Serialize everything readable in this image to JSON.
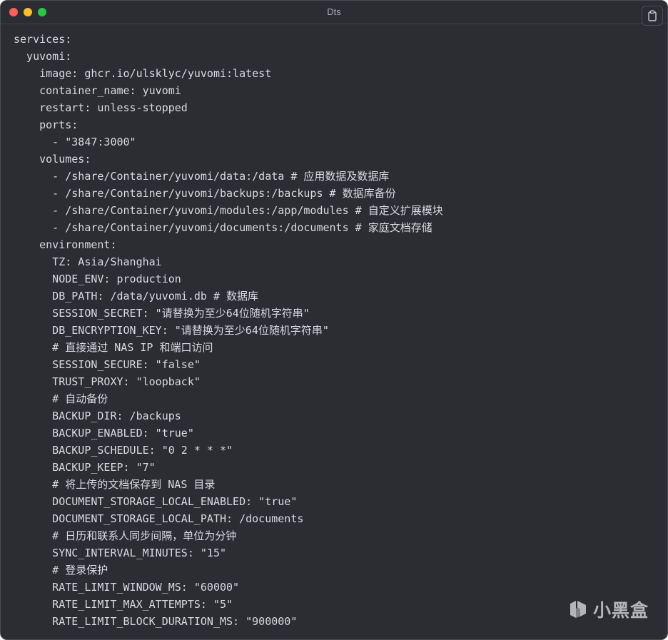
{
  "window": {
    "title": "Dts",
    "copy_icon": "clipboard-icon",
    "colors": {
      "background": "#2b2d33",
      "text": "#d7dae0",
      "close": "#ff5f57",
      "minimize": "#febc2e",
      "maximize": "#28c840"
    }
  },
  "code_lines": [
    "services:",
    "  yuvomi:",
    "    image: ghcr.io/ulsklyc/yuvomi:latest",
    "    container_name: yuvomi",
    "    restart: unless-stopped",
    "    ports:",
    "      - \"3847:3000\"",
    "    volumes:",
    "      - /share/Container/yuvomi/data:/data # 应用数据及数据库",
    "      - /share/Container/yuvomi/backups:/backups # 数据库备份",
    "      - /share/Container/yuvomi/modules:/app/modules # 自定义扩展模块",
    "      - /share/Container/yuvomi/documents:/documents # 家庭文档存储",
    "    environment:",
    "      TZ: Asia/Shanghai",
    "      NODE_ENV: production",
    "      DB_PATH: /data/yuvomi.db # 数据库",
    "      SESSION_SECRET: \"请替换为至少64位随机字符串\"",
    "      DB_ENCRYPTION_KEY: \"请替换为至少64位随机字符串\"",
    "      # 直接通过 NAS IP 和端口访问",
    "      SESSION_SECURE: \"false\"",
    "      TRUST_PROXY: \"loopback\"",
    "      # 自动备份",
    "      BACKUP_DIR: /backups",
    "      BACKUP_ENABLED: \"true\"",
    "      BACKUP_SCHEDULE: \"0 2 * * *\"",
    "      BACKUP_KEEP: \"7\"",
    "      # 将上传的文档保存到 NAS 目录",
    "      DOCUMENT_STORAGE_LOCAL_ENABLED: \"true\"",
    "      DOCUMENT_STORAGE_LOCAL_PATH: /documents",
    "      # 日历和联系人同步间隔，单位为分钟",
    "      SYNC_INTERVAL_MINUTES: \"15\"",
    "      # 登录保护",
    "      RATE_LIMIT_WINDOW_MS: \"60000\"",
    "      RATE_LIMIT_MAX_ATTEMPTS: \"5\"",
    "      RATE_LIMIT_BLOCK_DURATION_MS: \"900000\""
  ],
  "watermark": {
    "text": "小黑盒",
    "icon": "heybox-logo-icon"
  }
}
